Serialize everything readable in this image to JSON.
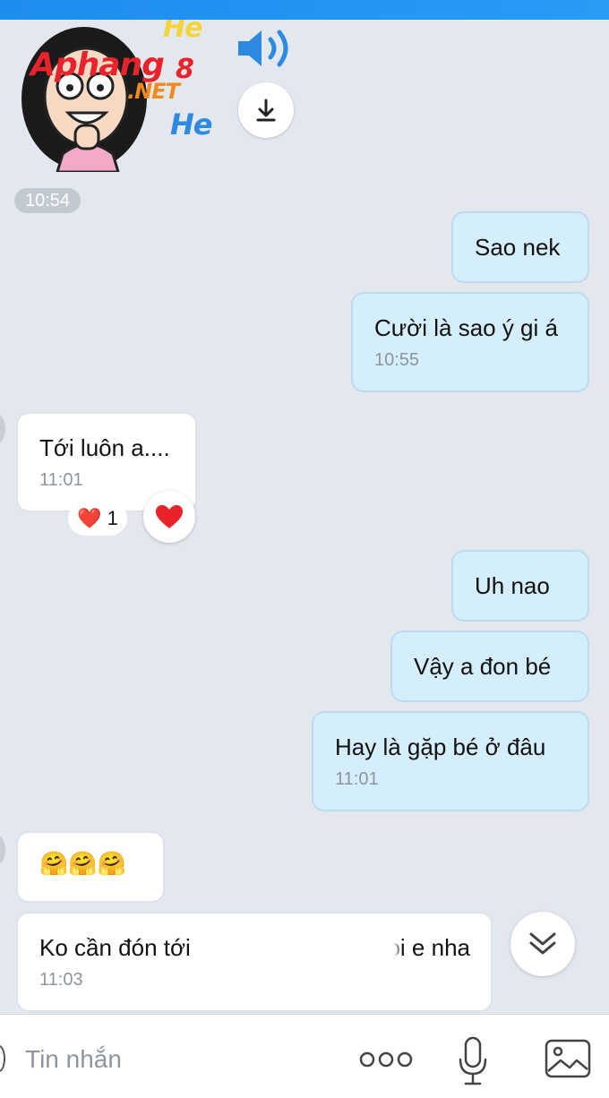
{
  "sticker": {
    "brand_line1": "Aphang",
    "brand_badge": "8",
    "brand_line2": ".NET",
    "laugh_top": "He",
    "laugh_bottom": "He"
  },
  "icons": {
    "voice": "speaker-icon",
    "download": "download-icon",
    "reaction": "heart-icon",
    "scroll_down": "double-chevron-down-icon",
    "more": "more-dots-icon",
    "mic": "microphone-icon",
    "image": "image-icon"
  },
  "timestamp_divider": "10:54",
  "messages": [
    {
      "direction": "out",
      "text": "Sao nek",
      "time": ""
    },
    {
      "direction": "out",
      "text": "Cười là sao ý gi á",
      "time": "10:55"
    },
    {
      "direction": "in",
      "text": "Tới luôn a....",
      "time": "11:01",
      "reaction": {
        "emoji": "❤️",
        "count": "1"
      }
    },
    {
      "direction": "out",
      "text": "Uh nao",
      "time": ""
    },
    {
      "direction": "out",
      "text": "Vậy a đon bé",
      "time": ""
    },
    {
      "direction": "out",
      "text": "Hay là gặp bé ở đâu",
      "time": "11:01"
    },
    {
      "direction": "in",
      "text": "🤗🤗🤗",
      "time": ""
    },
    {
      "direction": "in",
      "text_start": "Ko cần đón tới",
      "text_end": "gọi e nha",
      "time": "11:03"
    }
  ],
  "composer": {
    "placeholder": "Tin nhắn"
  },
  "colors": {
    "outgoing_bubble": "#d5eefc",
    "incoming_bubble": "#ffffff",
    "background": "#e3e8ef",
    "top_bar": "#1f8cf0"
  }
}
